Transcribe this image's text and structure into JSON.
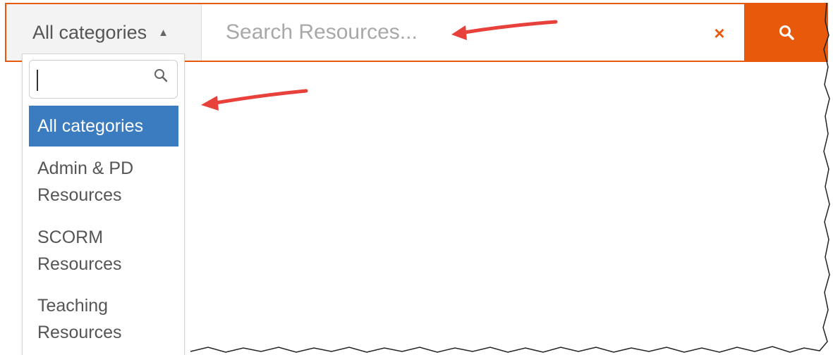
{
  "search": {
    "category_selected": "All categories",
    "caret": "▲",
    "placeholder": "Search Resources...",
    "clear_icon": "×",
    "search_icon": "search-icon"
  },
  "dropdown": {
    "filter_value": "",
    "items": [
      {
        "label": "All categories",
        "active": true
      },
      {
        "label": "Admin & PD Resources",
        "line1": "Admin & PD",
        "line2": "Resources"
      },
      {
        "label": "SCORM Resources",
        "line1": "SCORM",
        "line2": "Resources"
      },
      {
        "label": "Teaching Resources",
        "line1": "Teaching",
        "line2": "Resources"
      }
    ]
  },
  "colors": {
    "accent": "#e8590c",
    "active_item": "#3b7bbf",
    "annotation_arrow": "#e8403a"
  }
}
